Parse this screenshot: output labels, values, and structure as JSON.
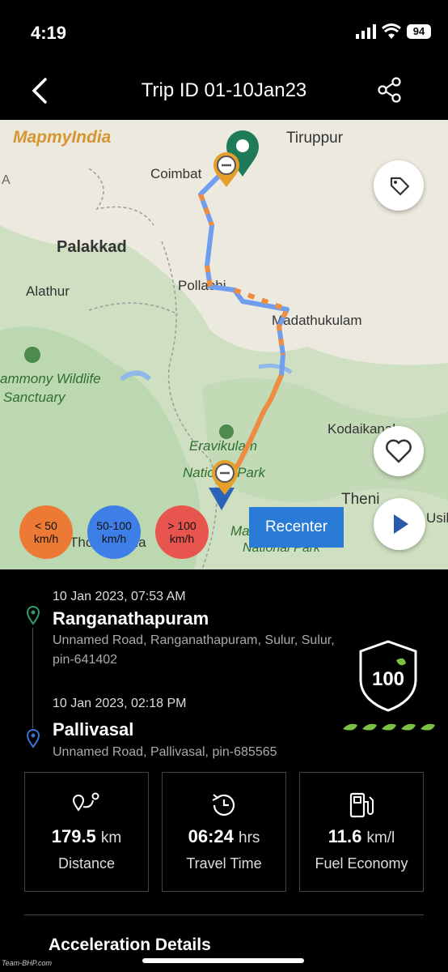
{
  "status_bar": {
    "time": "4:19",
    "battery": "94"
  },
  "nav": {
    "title": "Trip ID 01-10Jan23"
  },
  "map": {
    "brand": "MapmyIndia",
    "labels": {
      "tiruppur": "Tiruppur",
      "coimbatore": "Coimbat",
      "palakkad": "Palakkad",
      "alathur": "Alathur",
      "pollachi": "Pollachi",
      "madathukulam": "Madathukulam",
      "wildlife": "ammony Wildlife",
      "sanctuary": "Sanctuary",
      "eravikulam": "Eravikulam",
      "national_park": "National Park",
      "kodaikanal": "Kodaikanal",
      "theni": "Theni",
      "usil": "Usil",
      "thodupuzha": "Thodupuzha",
      "mathikettan": "Ma",
      "mathikettan2": "National Park",
      "edge_a": "A"
    },
    "legend": [
      {
        "line1": "< 50",
        "line2": "km/h",
        "color": "#ec7a34"
      },
      {
        "line1": "50-100",
        "line2": "km/h",
        "color": "#3d7fe6"
      },
      {
        "line1": "> 100",
        "line2": "km/h",
        "color": "#e8554f"
      }
    ],
    "recenter": "Recenter",
    "colors": {
      "route_blue": "#6f9df0",
      "route_orange": "#ef8d3e",
      "start_pin": "#1f7a57",
      "end_pin": "#2a63b8"
    }
  },
  "trip": {
    "start": {
      "datetime": "10 Jan 2023, 07:53 AM",
      "place": "Ranganathapuram",
      "address": "Unnamed Road, Ranganathapuram, Sulur, Sulur, pin-641402"
    },
    "end": {
      "datetime": "10 Jan 2023, 02:18 PM",
      "place": "Pallivasal",
      "address": "Unnamed Road, Pallivasal, pin-685565"
    },
    "score": "100",
    "leaves": 5
  },
  "stats": {
    "distance": {
      "value": "179.5",
      "unit": "km",
      "label": "Distance"
    },
    "travel_time": {
      "value": "06:24",
      "unit": "hrs",
      "label": "Travel Time"
    },
    "fuel_economy": {
      "value": "11.6",
      "unit": "km/l",
      "label": "Fuel Economy"
    }
  },
  "sections": {
    "acceleration": "Acceleration Details"
  },
  "watermark": "Team-BHP.com"
}
